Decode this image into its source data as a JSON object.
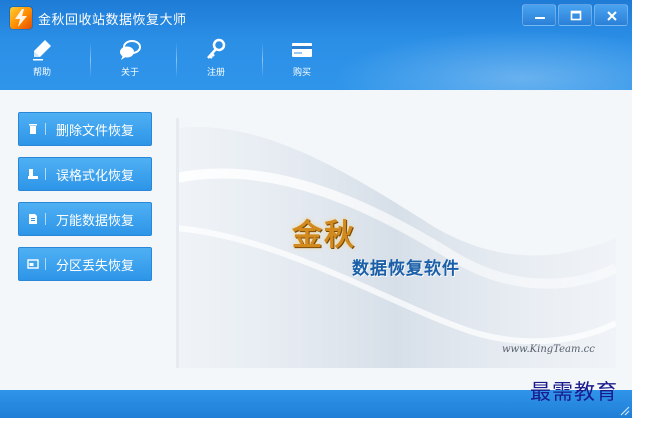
{
  "window": {
    "title": "金秋回收站数据恢复大师"
  },
  "toolbar": {
    "items": [
      {
        "label": "帮助",
        "icon": "pen-icon"
      },
      {
        "label": "关于",
        "icon": "chat-bubble-icon"
      },
      {
        "label": "注册",
        "icon": "key-icon"
      },
      {
        "label": "购买",
        "icon": "card-icon"
      }
    ]
  },
  "sidebar": {
    "items": [
      {
        "label": "删除文件恢复",
        "icon": "trash-icon"
      },
      {
        "label": "误格式化恢复",
        "icon": "drive-icon"
      },
      {
        "label": "万能数据恢复",
        "icon": "document-icon"
      },
      {
        "label": "分区丢失恢复",
        "icon": "partition-icon"
      }
    ]
  },
  "banner": {
    "brand": "金秋",
    "subtitle": "数据恢复软件",
    "url": "www.KingTeam.cc"
  },
  "watermark": "最需教育",
  "colors": {
    "titlebar": "#2b8fe6",
    "button": "#2d95e8",
    "brand_gold": "#d28a1e",
    "brand_blue": "#1a5fa8"
  }
}
